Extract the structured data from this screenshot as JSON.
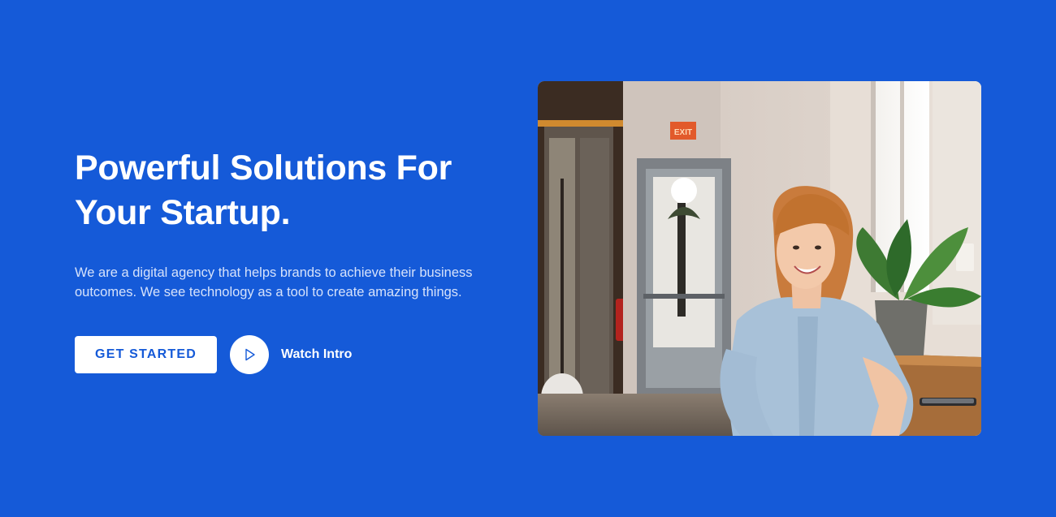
{
  "hero": {
    "title": "Powerful Solutions For Your Startup.",
    "description": "We are a digital agency that helps brands to achieve their business outcomes. We see technology as a tool to create amazing things.",
    "primary_button": "GET STARTED",
    "secondary_link": "Watch Intro",
    "exit_sign": "EXIT",
    "icons": {
      "play": "play-icon"
    },
    "image_subject": "smiling woman in a cafe"
  },
  "colors": {
    "background": "#155ad8",
    "button_bg": "#ffffff",
    "button_text": "#155ad8",
    "heading": "#ffffff",
    "body_text": "#d6e2fb"
  }
}
